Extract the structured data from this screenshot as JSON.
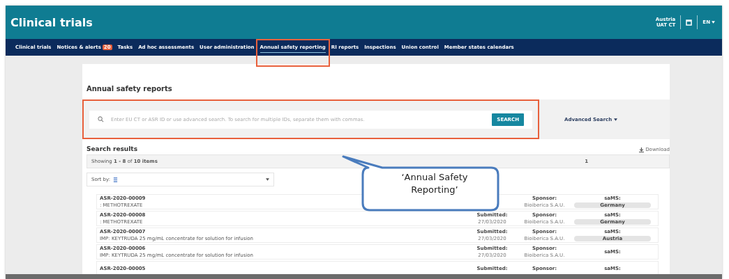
{
  "header": {
    "title": "Clinical trials",
    "user": {
      "country": "Austria",
      "role": "UAT CT"
    },
    "language": "EN"
  },
  "nav": [
    {
      "label": "Clinical trials",
      "selected": false
    },
    {
      "label": "Notices & alerts",
      "badge": "20",
      "selected": false
    },
    {
      "label": "Tasks",
      "selected": false
    },
    {
      "label": "Ad hoc assessments",
      "selected": false
    },
    {
      "label": "User administration",
      "selected": false
    },
    {
      "label": "Annual safety reporting",
      "selected": true,
      "highlighted": true
    },
    {
      "label": "RI reports",
      "selected": false
    },
    {
      "label": "Inspections",
      "selected": false
    },
    {
      "label": "Union control",
      "selected": false
    },
    {
      "label": "Member states calendars",
      "selected": false
    }
  ],
  "page": {
    "title": "Annual safety reports",
    "search": {
      "placeholder": "Enter EU CT or ASR ID or use advanced search. To search for multiple IDs, separate them with commas.",
      "button": "SEARCH",
      "highlighted": true
    },
    "advanced_search": "Advanced Search",
    "results_title": "Search results",
    "download": "Download",
    "summary": {
      "prefix": "Showing",
      "range": "1 - 8",
      "middle": "of",
      "total": "10 items"
    },
    "page_number": "1",
    "sort_label": "Sort by:",
    "rows": [
      {
        "id": "ASR-2020-00009",
        "product": ": METHOTREXATE",
        "sponsor_label": "Sponsor:",
        "sponsor": "Bioiberica S.A.U.",
        "sams_label": "saMS:",
        "sams": "Germany"
      },
      {
        "id": "ASR-2020-00008",
        "product": ": METHOTREXATE",
        "submitted_label": "Submitted:",
        "submitted": "27/03/2020",
        "sponsor_label": "Sponsor:",
        "sponsor": "Bioiberica S.A.U.",
        "sams_label": "saMS:",
        "sams": "Germany"
      },
      {
        "id": "ASR-2020-00007",
        "product": "IMP: KEYTRUDA 25 mg/mL concentrate for solution for infusion",
        "submitted_label": "Submitted:",
        "submitted": "27/03/2020",
        "sponsor_label": "Sponsor:",
        "sponsor": "Bioiberica S.A.U.",
        "sams_label": "saMS:",
        "sams": "Austria"
      },
      {
        "id": "ASR-2020-00006",
        "product": "IMP: KEYTRUDA 25 mg/mL concentrate for solution for infusion",
        "submitted_label": "Submitted:",
        "submitted": "27/03/2020",
        "sponsor_label": "Sponsor:",
        "sponsor": "Bioiberica S.A.U.",
        "sams_label": "saMS:"
      },
      {
        "id": "ASR-2020-00005",
        "submitted_label": "Submitted:",
        "sponsor_label": "Sponsor:",
        "sams_label": "saMS:"
      }
    ]
  },
  "callout": {
    "text": "‘Annual Safety Reporting’"
  }
}
